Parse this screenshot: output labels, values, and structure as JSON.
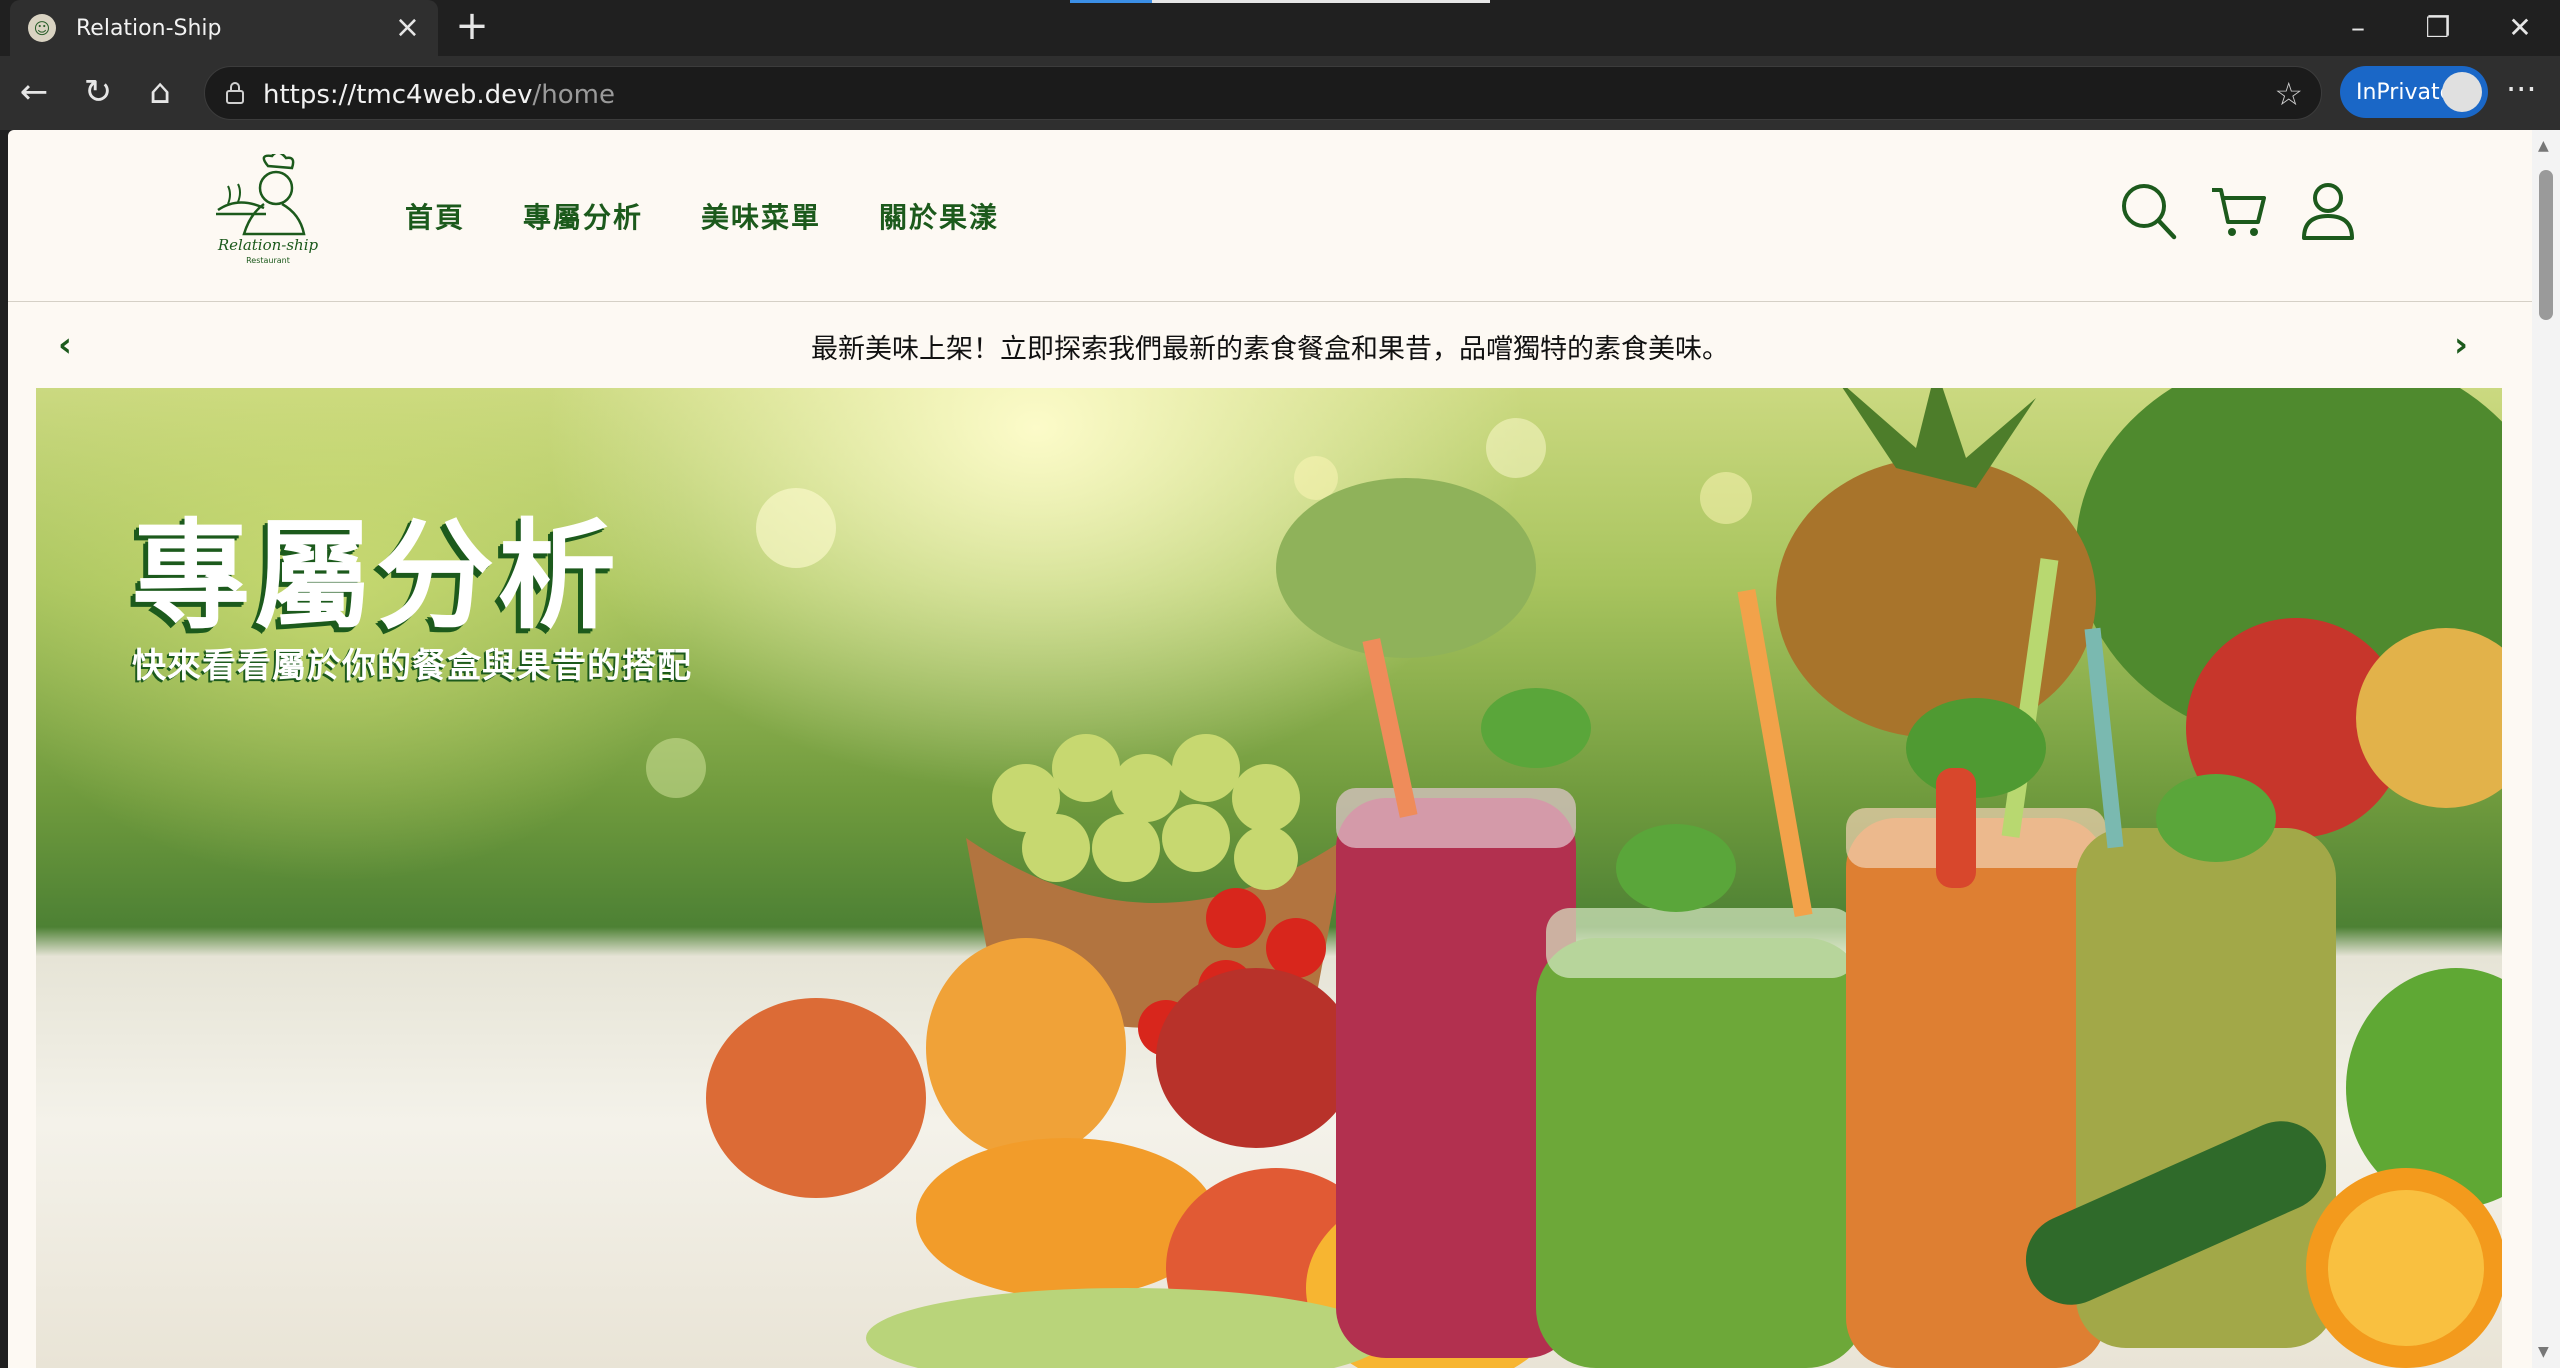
{
  "browser": {
    "tab_title": "Relation-Ship",
    "url_host": "https://tmc4web.dev",
    "url_path": "/home",
    "profile_label": "InPrivate"
  },
  "site": {
    "logo_text": "Relation-ship",
    "logo_subtext": "Restaurant",
    "nav": [
      "首頁",
      "專屬分析",
      "美味菜單",
      "關於果漾"
    ],
    "promo_text": "最新美味上架！立即探索我們最新的素食餐盒和果昔，品嚐獨特的素食美味。",
    "hero_title": "專屬分析",
    "hero_subtitle": "快來看看屬於你的餐盒與果昔的搭配",
    "brand_color": "#1c5a1c",
    "background_color": "#fdf9f3"
  },
  "icons": [
    "search-icon",
    "cart-icon",
    "account-icon",
    "chevron-left-icon",
    "chevron-right-icon"
  ]
}
